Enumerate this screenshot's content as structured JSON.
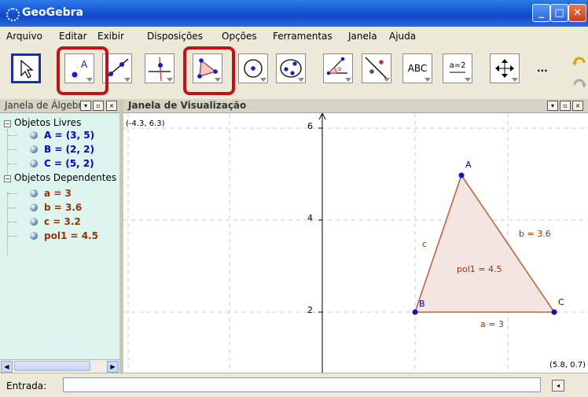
{
  "window": {
    "title": "GeoGebra"
  },
  "menu": [
    "Arquivo",
    "Editar",
    "Exibir",
    "Disposições",
    "Opções",
    "Ferramentas",
    "Janela",
    "Ajuda"
  ],
  "toolbar": {
    "text_tool_label": "ABC",
    "slider_tool_label": "a=2",
    "more_label": "..."
  },
  "algebra": {
    "header": "Janela de Álgebra",
    "free_group": "Objetos Livres",
    "dependent_group": "Objetos Dependentes",
    "free": [
      "A = (3, 5)",
      "B = (2, 2)",
      "C = (5, 2)"
    ],
    "dependent": [
      "a = 3",
      "b = 3.6",
      "c = 3.2",
      "pol1 = 4.5"
    ]
  },
  "graphics": {
    "header": "Janela de Visualização",
    "corner_top_left": "(-4.3, 6.3)",
    "corner_bottom_right": "(5.8, 0.7)",
    "y_ticks": [
      "2",
      "4",
      "6"
    ],
    "points": [
      {
        "name": "A",
        "x": 3,
        "y": 5
      },
      {
        "name": "B",
        "x": 2,
        "y": 2
      },
      {
        "name": "C",
        "x": 5,
        "y": 2
      }
    ],
    "segment_labels": {
      "a": "a = 3",
      "b": "b = 3.6",
      "c": "c"
    },
    "polygon_label": "pol1 = 4.5",
    "colors": {
      "polygon_fill": "#f3e6e2",
      "polygon_stroke": "#c0643c",
      "point": "#1111cc",
      "label_brown": "#993300",
      "label_blue": "#0000d8"
    }
  },
  "input": {
    "label": "Entrada:",
    "value": ""
  }
}
